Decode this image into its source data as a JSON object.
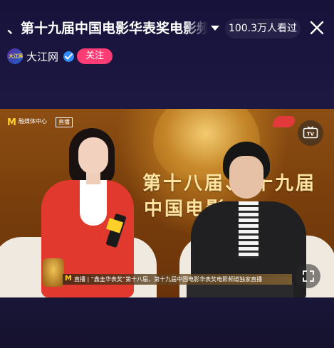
{
  "header": {
    "title": "、第十九届中国电影华表奖电影频",
    "viewers": "100.3万人看过"
  },
  "account": {
    "name": "大江网",
    "avatar_text": "大江网",
    "follow_label": "关注"
  },
  "video": {
    "watermark_m": "M",
    "watermark_text": "融媒体中心",
    "live_tag": "直播",
    "background_text_line1": "第十八届、 十九届",
    "background_text_line2": "中国电影",
    "lower_third_m": "M",
    "lower_third_text": "直播 | “鑫圭华表奖”第十八届、第十九届中国电影华表奖电影频道独家直播"
  },
  "colors": {
    "background": "#1b1838",
    "follow_button": "#ff3d74",
    "verified_badge": "#2f8cff",
    "accent_yellow": "#ffcf2a"
  },
  "icons": [
    "chevron-down-icon",
    "close-icon",
    "verified-icon",
    "tv-cast-icon",
    "fullscreen-icon"
  ]
}
